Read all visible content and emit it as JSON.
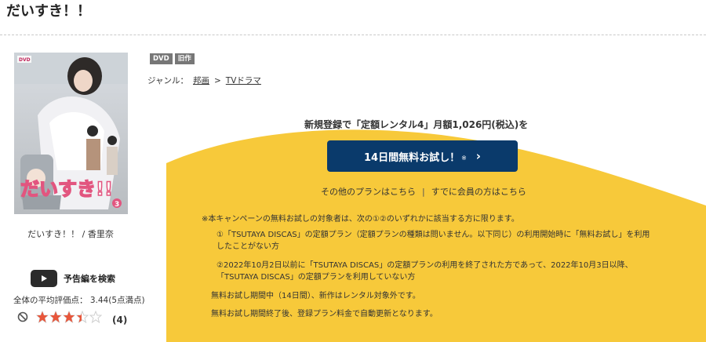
{
  "page": {
    "title": "だいすき！！"
  },
  "item": {
    "caption": "だいすき！！ / 香里奈",
    "cover_text": "だいすき!!",
    "cover_badge": "DVD",
    "cover_vol": "3",
    "trailer_label": "予告編を検索",
    "average_rating": "全体の平均評価点： 3.44(5点満点)",
    "rating_value": 3.44,
    "review_count": "(4)",
    "colors": {
      "star": "#e8563b",
      "star_empty": "#cfcfcf"
    }
  },
  "tags": [
    "DVD",
    "旧作"
  ],
  "genre": {
    "label": "ジャンル：",
    "items": [
      "邦画",
      "TVドラマ"
    ],
    "separator": ">"
  },
  "promo": {
    "headline": "新規登録で「定額レンタル4」月額1,026円(税込)を",
    "button_label": "14日間無料お試し！",
    "button_note": "※",
    "other_plans": "その他のプランはこちら",
    "divider": "|",
    "members": "すでに会員の方はこちら",
    "notes": [
      "※本キャンペーンの無料お試しの対象者は、次の①②のいずれかに該当する方に限ります。",
      "①「TSUTAYA DISCAS」の定額プラン（定額プランの種類は問いません。以下同じ）の利用開始時に「無料お試し」を利用したことがない方",
      "②2022年10月2日以前に「TSUTAYA DISCAS」の定額プランの利用を終了された方であって、2022年10月3日以降、「TSUTAYA DISCAS」の定額プランを利用していない方",
      "無料お試し期間中（14日間）、新作はレンタル対象外です。",
      "無料お試し期間終了後、登録プラン料金で自動更新となります。"
    ],
    "colors": {
      "yellow": "#f7c93a",
      "button": "#0a3a6b"
    }
  }
}
